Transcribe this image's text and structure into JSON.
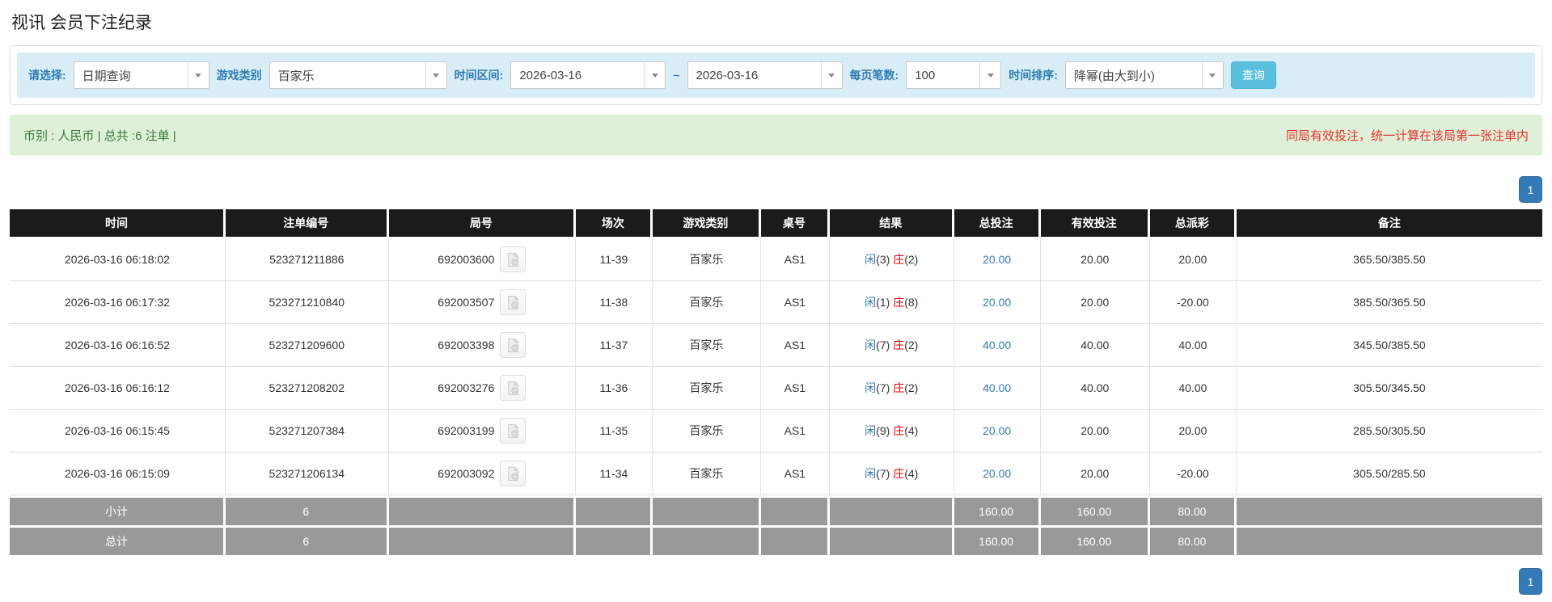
{
  "page": {
    "title": "视讯 会员下注纪录"
  },
  "filter": {
    "select_label": "请选择:",
    "select_value": "日期查询",
    "game_type_label": "游戏类别",
    "game_type_value": "百家乐",
    "time_range_label": "时间区间:",
    "date_from": "2026-03-16",
    "tilde": "~",
    "date_to": "2026-03-16",
    "page_size_label": "每页笔数:",
    "page_size_value": "100",
    "sort_label": "时间排序:",
    "sort_value": "降幂(由大到小)",
    "search_button": "查询"
  },
  "summary": {
    "left": "币别 : 人民币 | 总共 :6 注单 |",
    "right": "同局有效投注，统一计算在该局第一张注单内"
  },
  "pagination": {
    "page": "1"
  },
  "icons": {
    "video_icon": "video-replay-icon",
    "chevron": "chevron-down-icon"
  },
  "colors": {
    "filter_bg": "#d9edf7",
    "label_blue": "#2e7db2",
    "search_button_blue": "#5bc0de",
    "summary_bg": "#dff0d8",
    "summary_text_green": "#3c763d",
    "notice_red": "#e4342e",
    "header_bg": "#1b1b1b",
    "footer_bg": "#999999",
    "link_blue": "#337ab7",
    "negative_red": "#e60000",
    "pagination_blue": "#337ab7"
  },
  "table": {
    "headers": [
      "时间",
      "注单编号",
      "局号",
      "场次",
      "游戏类别",
      "桌号",
      "结果",
      "总投注",
      "有效投注",
      "总派彩",
      "备注"
    ],
    "player_label": "闲",
    "banker_label": "庄",
    "rows": [
      {
        "time": "2026-03-16 06:18:02",
        "bet_id": "523271211886",
        "round_id": "692003600",
        "session": "11-39",
        "game": "百家乐",
        "table_no": "AS1",
        "player_num": "(3)",
        "banker_num": "(2)",
        "total_bet": "20.00",
        "valid_bet": "20.00",
        "payout": "20.00",
        "remark": "365.50/385.50"
      },
      {
        "time": "2026-03-16 06:17:32",
        "bet_id": "523271210840",
        "round_id": "692003507",
        "session": "11-38",
        "game": "百家乐",
        "table_no": "AS1",
        "player_num": "(1)",
        "banker_num": "(8)",
        "total_bet": "20.00",
        "valid_bet": "20.00",
        "payout": "-20.00",
        "remark": "385.50/365.50"
      },
      {
        "time": "2026-03-16 06:16:52",
        "bet_id": "523271209600",
        "round_id": "692003398",
        "session": "11-37",
        "game": "百家乐",
        "table_no": "AS1",
        "player_num": "(7)",
        "banker_num": "(2)",
        "total_bet": "40.00",
        "valid_bet": "40.00",
        "payout": "40.00",
        "remark": "345.50/385.50"
      },
      {
        "time": "2026-03-16 06:16:12",
        "bet_id": "523271208202",
        "round_id": "692003276",
        "session": "11-36",
        "game": "百家乐",
        "table_no": "AS1",
        "player_num": "(7)",
        "banker_num": "(2)",
        "total_bet": "40.00",
        "valid_bet": "40.00",
        "payout": "40.00",
        "remark": "305.50/345.50"
      },
      {
        "time": "2026-03-16 06:15:45",
        "bet_id": "523271207384",
        "round_id": "692003199",
        "session": "11-35",
        "game": "百家乐",
        "table_no": "AS1",
        "player_num": "(9)",
        "banker_num": "(4)",
        "total_bet": "20.00",
        "valid_bet": "20.00",
        "payout": "20.00",
        "remark": "285.50/305.50"
      },
      {
        "time": "2026-03-16 06:15:09",
        "bet_id": "523271206134",
        "round_id": "692003092",
        "session": "11-34",
        "game": "百家乐",
        "table_no": "AS1",
        "player_num": "(7)",
        "banker_num": "(4)",
        "total_bet": "20.00",
        "valid_bet": "20.00",
        "payout": "-20.00",
        "remark": "305.50/285.50"
      }
    ],
    "subtotal": {
      "label": "小计",
      "count": "6",
      "total_bet": "160.00",
      "valid_bet": "160.00",
      "payout": "80.00"
    },
    "total": {
      "label": "总计",
      "count": "6",
      "total_bet": "160.00",
      "valid_bet": "160.00",
      "payout": "80.00"
    }
  }
}
